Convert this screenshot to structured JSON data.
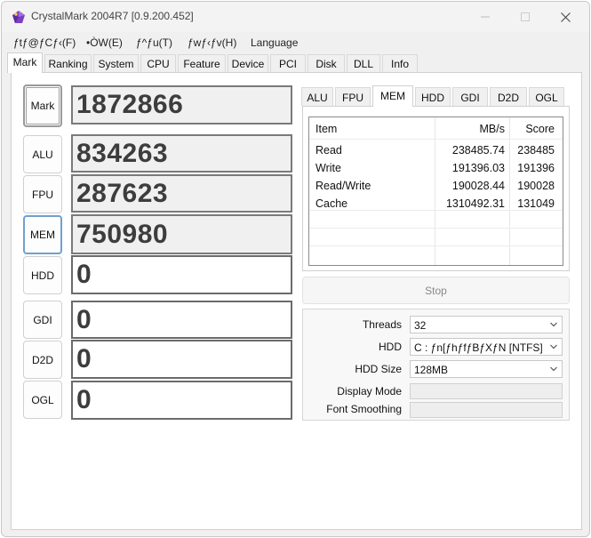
{
  "window": {
    "title": "CrystalMark 2004R7 [0.9.200.452]"
  },
  "menu": [
    {
      "label": "ƒtƒ@ƒCƒ‹(F)"
    },
    {
      "label": "•ÒW(E)"
    },
    {
      "label": "ƒ^ƒu(T)"
    },
    {
      "label": "ƒwƒ‹ƒv(H)"
    },
    {
      "label": "Language"
    }
  ],
  "main_tabs": [
    {
      "label": "Mark",
      "active": true
    },
    {
      "label": "Ranking"
    },
    {
      "label": "System"
    },
    {
      "label": "CPU"
    },
    {
      "label": "Feature"
    },
    {
      "label": "Device"
    },
    {
      "label": "PCI"
    },
    {
      "label": "Disk"
    },
    {
      "label": "DLL"
    },
    {
      "label": "Info"
    }
  ],
  "scores": [
    {
      "label": "Mark",
      "value": "1872866"
    },
    {
      "label": "ALU",
      "value": "834263"
    },
    {
      "label": "FPU",
      "value": "287623"
    },
    {
      "label": "MEM",
      "value": "750980"
    },
    {
      "label": "HDD",
      "value": "0"
    },
    {
      "label": "GDI",
      "value": "0"
    },
    {
      "label": "D2D",
      "value": "0"
    },
    {
      "label": "OGL",
      "value": "0"
    }
  ],
  "sub_tabs": [
    {
      "label": "ALU"
    },
    {
      "label": "FPU"
    },
    {
      "label": "MEM",
      "active": true
    },
    {
      "label": "HDD"
    },
    {
      "label": "GDI"
    },
    {
      "label": "D2D"
    },
    {
      "label": "OGL"
    }
  ],
  "table": {
    "headers": [
      "Item",
      "MB/s",
      "Score"
    ],
    "rows": [
      [
        "Read",
        "238485.74",
        "238485"
      ],
      [
        "Write",
        "191396.03",
        "191396"
      ],
      [
        "Read/Write",
        "190028.44",
        "190028"
      ],
      [
        "Cache",
        "1310492.31",
        "131049"
      ]
    ]
  },
  "stop_button": {
    "label": "Stop"
  },
  "settings": {
    "threads": {
      "label": "Threads",
      "value": "32"
    },
    "hdd": {
      "label": "HDD",
      "value": "C : ƒn[ƒhƒfƒBƒXƒN [NTFS]"
    },
    "hdd_size": {
      "label": "HDD Size",
      "value": "128MB"
    },
    "display_mode": {
      "label": "Display Mode"
    },
    "font_smoothing": {
      "label": "Font Smoothing"
    }
  },
  "colors": {
    "active_border": "#6fa0d0",
    "score_text": "#3d3d3d"
  }
}
